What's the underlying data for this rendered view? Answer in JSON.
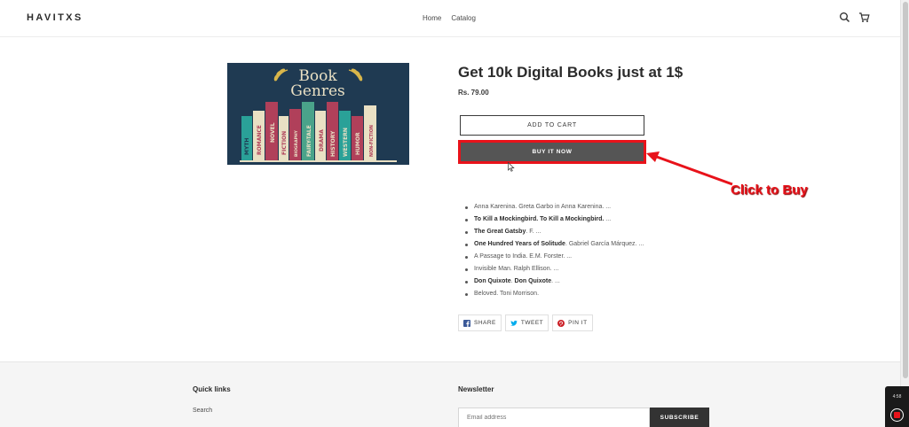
{
  "header": {
    "logo": "HAVITXS",
    "nav": [
      "Home",
      "Catalog"
    ],
    "icons": [
      "search-icon",
      "cart-icon"
    ]
  },
  "product": {
    "image": {
      "heading_line1": "Book",
      "heading_line2": "Genres",
      "spines": [
        "MYTH",
        "ROMANCE",
        "NOVEL",
        "FICTION",
        "BIOGRAPHY",
        "FAIRY-TALE",
        "DRAMA",
        "HISTORY",
        "WESTERN",
        "HUMOR",
        "NON-FICTION"
      ]
    },
    "title": "Get 10k Digital Books just at 1$",
    "price": "Rs. 79.00",
    "add_to_cart": "ADD TO CART",
    "buy_now": "BUY IT NOW"
  },
  "annotation": {
    "text": "Click to Buy",
    "color": "#e8121a"
  },
  "books": [
    {
      "bold": "",
      "text": "Anna Karenina. Greta Garbo in Anna Karenina. ..."
    },
    {
      "bold": "To Kill a Mockingbird. To Kill a Mockingbird.",
      "text": " ..."
    },
    {
      "bold": "The Great Gatsby",
      "text": ". F. ..."
    },
    {
      "bold": "One Hundred Years of Solitude",
      "text": ". Gabriel García Márquez. ..."
    },
    {
      "bold": "",
      "text": "A Passage to India. E.M. Forster. ..."
    },
    {
      "bold": "",
      "text": "Invisible Man. Ralph Ellison. ..."
    },
    {
      "bold": "Don Quixote",
      "text": ". Don Quixote. ..."
    },
    {
      "bold": "",
      "text": "Beloved. Toni Morrison."
    }
  ],
  "books_extra_bold": {
    "don_quixote_second": "Don Quixote"
  },
  "share": [
    {
      "label": "SHARE",
      "icon": "facebook-icon",
      "color": "#3b5998"
    },
    {
      "label": "TWEET",
      "icon": "twitter-icon",
      "color": "#00aced"
    },
    {
      "label": "PIN IT",
      "icon": "pinterest-icon",
      "color": "#cb2027"
    }
  ],
  "footer": {
    "quick_links_title": "Quick links",
    "quick_links": [
      "Search"
    ],
    "newsletter_title": "Newsletter",
    "email_placeholder": "Email address",
    "subscribe_label": "SUBSCRIBE"
  },
  "recorder": {
    "time": "4:58"
  }
}
